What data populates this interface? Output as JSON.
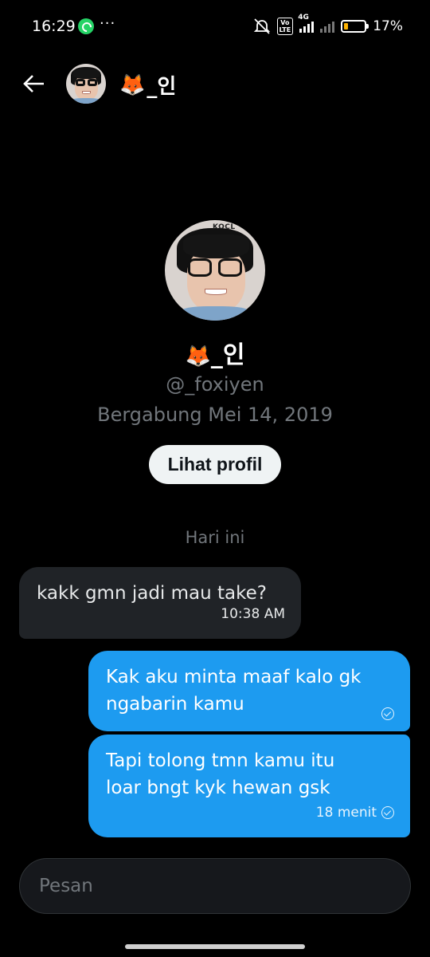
{
  "status_bar": {
    "time": "16:29",
    "dots": "···",
    "volte": "Vo LTE",
    "network": "4G",
    "battery_percent": "17%",
    "battery_level": 0.17,
    "icons": [
      "whatsapp-icon",
      "mute-icon",
      "signal-icon",
      "battery-icon"
    ]
  },
  "header": {
    "name_emoji": "🦊",
    "name_text": "_인"
  },
  "profile": {
    "name_emoji": "🦊",
    "name_text": "_인",
    "handle": "@_foxiyen",
    "joined": "Bergabung Mei 14, 2019",
    "avatar_caption": "KOCL",
    "view_profile_label": "Lihat profil"
  },
  "conversation": {
    "day_label": "Hari ini",
    "messages": [
      {
        "direction": "incoming",
        "text": "kakk gmn jadi mau take?",
        "time": "10:38 AM"
      },
      {
        "direction": "outgoing",
        "text_lines": [
          "Kak aku minta maaf kalo gk",
          "ngabarin kamu"
        ],
        "time": ""
      },
      {
        "direction": "outgoing",
        "text_lines": [
          "Tapi tolong tmn kamu itu",
          "loar bngt kyk hewan gsk"
        ],
        "time": "18 menit"
      }
    ]
  },
  "composer": {
    "placeholder": "Pesan"
  },
  "colors": {
    "background": "#000000",
    "outgoing_bubble": "#1d9bf0",
    "incoming_bubble": "#202327",
    "secondary_text": "#71767b"
  }
}
